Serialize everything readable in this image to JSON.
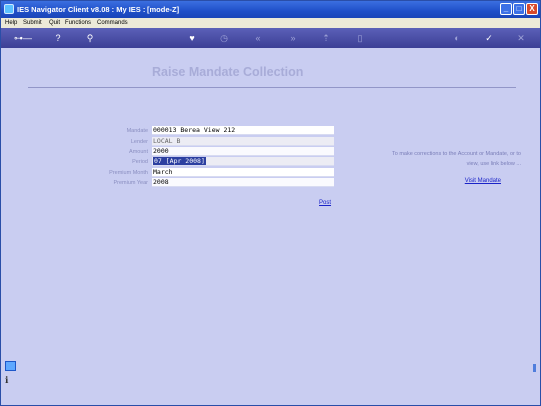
{
  "window": {
    "app_title": "IES Navigator Client v8.08 : My IES :",
    "mode": "[mode-Z]",
    "controls": [
      "_",
      "□",
      "X"
    ]
  },
  "menu": {
    "items": [
      "Help",
      "Submit",
      "Quit",
      "Functions",
      "Commands"
    ]
  },
  "toolbar": {
    "icons": [
      "key-icon",
      "help-icon",
      "search-icon",
      "heart-icon",
      "clock-icon",
      "rewind-icon",
      "forward-icon",
      "upload-icon",
      "document-icon",
      "globe-icon",
      "check-icon",
      "close-icon"
    ]
  },
  "form": {
    "title": "Raise Mandate Collection",
    "fields": [
      {
        "label": "Mandate",
        "value": "000013 Berea View 212"
      },
      {
        "label": "Lender",
        "value": "LOCAL B"
      },
      {
        "label": "Amount",
        "value": "2000"
      },
      {
        "label": "Period",
        "value": "07 [Apr 2008]"
      },
      {
        "label": "Premium Month",
        "value": "March"
      },
      {
        "label": "Premium Year",
        "value": "2008"
      }
    ],
    "post_label": "Post"
  },
  "help": {
    "text": "To make corrections to the Account or Mandate, or to view, use link below ...",
    "link": "Visit Mandate"
  }
}
